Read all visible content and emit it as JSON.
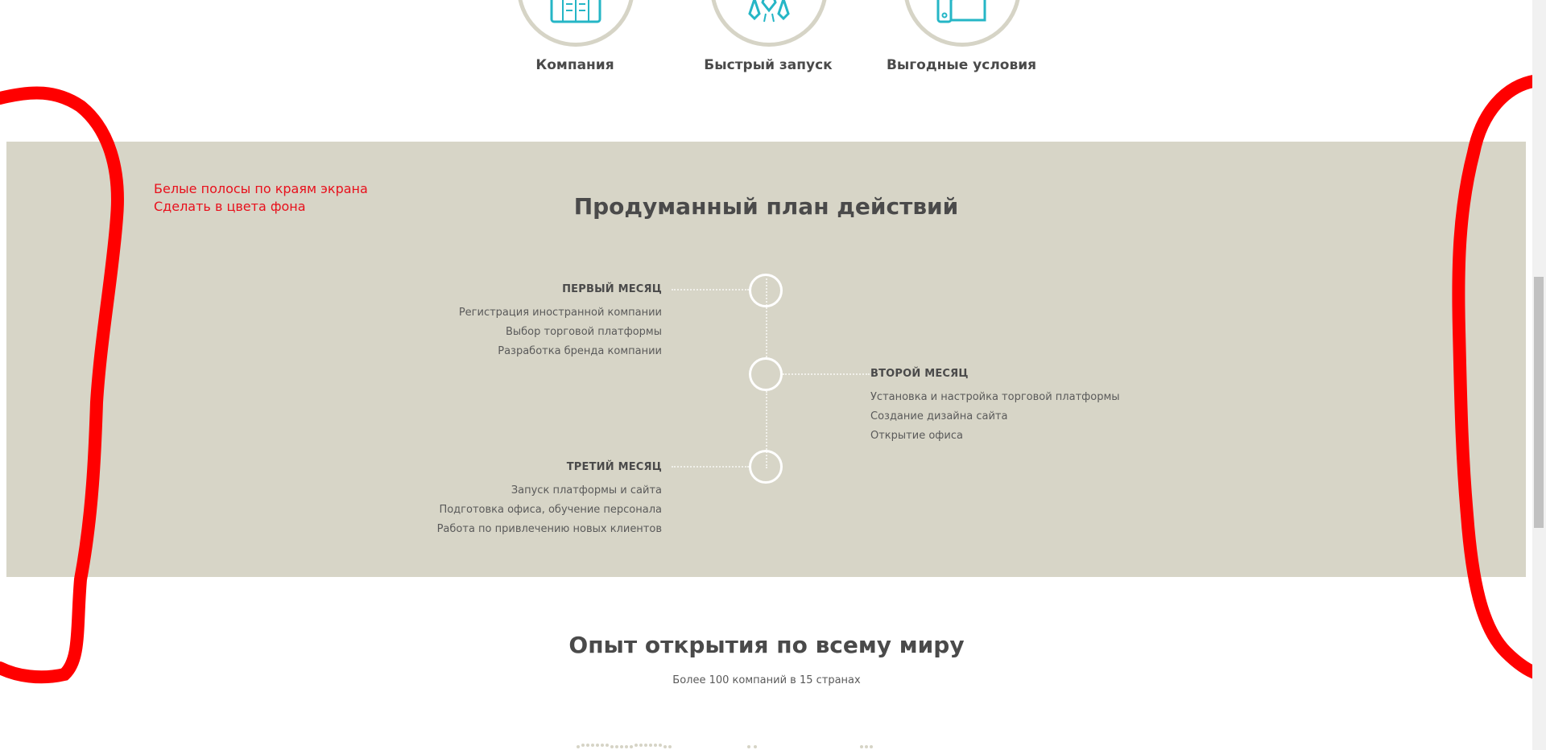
{
  "features": [
    {
      "label": "Компания",
      "icon": "building-icon"
    },
    {
      "label": "Быстрый запуск",
      "icon": "rocket-icon"
    },
    {
      "label": "Выгодные условия",
      "icon": "thumbs-up-icon"
    }
  ],
  "annotation": {
    "line1": "Белые полосы по краям экрана",
    "line2": "Сделать в цвета фона",
    "color": "#e8101c"
  },
  "plan": {
    "title": "Продуманный план действий",
    "background": "#d7d5c7",
    "months": [
      {
        "title": "ПЕРВЫЙ МЕСЯЦ",
        "items": [
          "Регистрация иностранной компании",
          "Выбор торговой платформы",
          "Разработка бренда компании"
        ]
      },
      {
        "title": "ВТОРОЙ МЕСЯЦ",
        "items": [
          "Установка и настройка торговой платформы",
          "Создание дизайна сайта",
          "Открытие офиса"
        ]
      },
      {
        "title": "ТРЕТИЙ МЕСЯЦ",
        "items": [
          "Запуск платформы и сайта",
          "Подготовка офиса, обучение персонала",
          "Работа по привлечению новых клиентов"
        ]
      }
    ]
  },
  "world": {
    "title": "Опыт открытия по всему миру",
    "subtitle": "Более 100 компаний в 15 странах"
  },
  "colors": {
    "accent": "#25b6c6",
    "marker": "#ff0000"
  }
}
